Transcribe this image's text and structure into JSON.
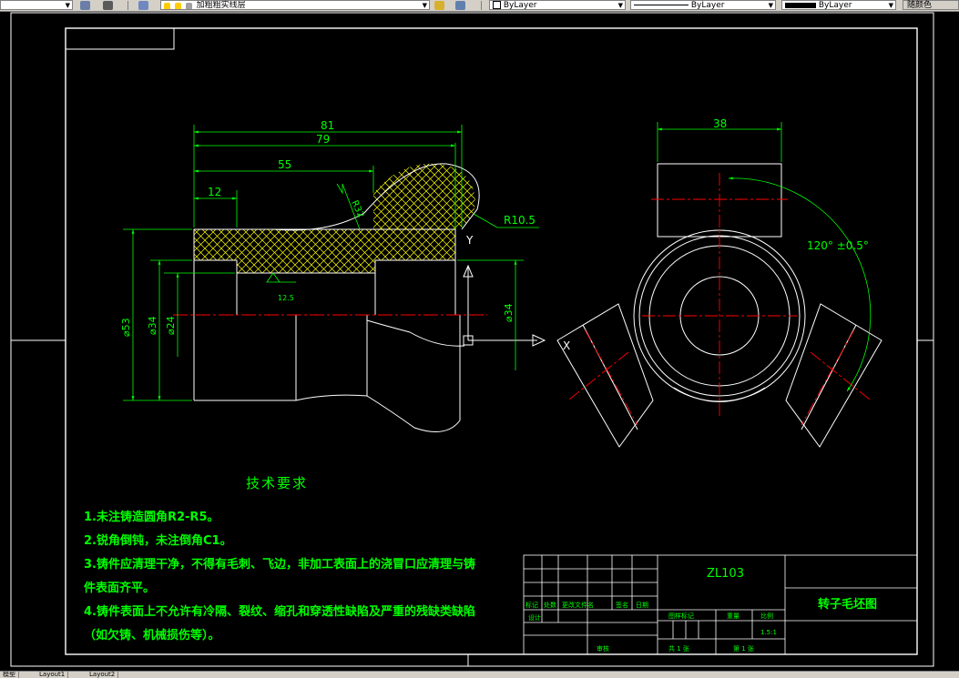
{
  "toolbar": {
    "layer_name": "加粗粗实线层",
    "color_value": "ByLayer",
    "linetype_value": "ByLayer",
    "lineweight_value": "ByLayer",
    "plotstyle_value": "随颜色",
    "colors": {
      "background": "#d4d0c8",
      "layer_icon": "#ffcc00"
    }
  },
  "drawing": {
    "dims": {
      "d81": "81",
      "d79": "79",
      "d55": "55",
      "d12": "12",
      "r32": "R32",
      "r105": "R10.5",
      "phi53": "⌀53",
      "phi34_left": "⌀34",
      "phi24": "⌀24",
      "phi34_right": "⌀34",
      "rough": "12.5",
      "d38": "38",
      "angle": "120° ±0.5°",
      "y_axis": "Y"
    },
    "tech_title": "技术要求",
    "notes": [
      "1.未注铸造圆角R2-R5。",
      "2.锐角倒钝，未注倒角C1。",
      "3.铸件应清理干净，不得有毛刺、飞边，非加工表面上的浇冒口应清理与铸",
      "件表面齐平。",
      "4.铸件表面上不允许有冷隔、裂纹、缩孔和穿透性缺陷及严重的残缺类缺陷",
      "（如欠铸、机械损伤等）。"
    ],
    "title_block": {
      "code": "ZL103",
      "name": "转子毛坯图",
      "header_cells": [
        "标记",
        "处数",
        "更改文件名",
        "签名",
        "日期"
      ],
      "design": "设计",
      "stage": "图样标记",
      "weight": "重量",
      "scale_label": "比例",
      "scale": "1.5:1",
      "review": "审核",
      "total": "共 1 张",
      "sheet": "第 1 张"
    },
    "colors": {
      "line": "#ffffff",
      "dim": "#00ff00",
      "center": "#ff0000",
      "hatch": "#ffff00"
    }
  },
  "tabs": [
    "模型",
    "Layout1",
    "Layout2"
  ]
}
